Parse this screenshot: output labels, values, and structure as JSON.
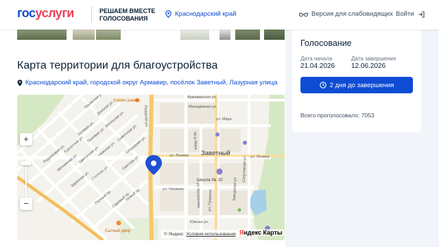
{
  "header": {
    "logo_part1": "гос",
    "logo_part2": "услуги",
    "slogan_line1": "РЕШАЕМ ВМЕСТЕ",
    "slogan_line2": "ГОЛОСОВАНИЯ",
    "region": "Краснодарский край",
    "accessibility": "Версия для слабовидящих",
    "login": "Войти"
  },
  "main": {
    "title": "Карта территории для благоустройства",
    "address": "Краснодарский край, городской округ Армавир, посёлок Заветный, Лазурная улица"
  },
  "map": {
    "pois": {
      "golden_palace": "Golden palace",
      "school": "Школа № 20",
      "sytny_dvor": "Сытный двор",
      "district": "Заветный"
    },
    "streets": {
      "lazurnaya": "Лазурная ул.",
      "armavirskaya": "Армавирская ул.",
      "molodezhnaya": "Молодёжная ул.",
      "mira": "ул. Мира",
      "lenina_w": "ул. Ленина",
      "lenina_e": "ул. Ленина",
      "chapaeva": "ул. Чапаева",
      "matrosova": "ул. Матросова",
      "pushkina": "ул. Пушкина",
      "zavodskaya": "Заводская ул.",
      "sportivnaya": "Спортивная ул.",
      "yuzhnaya": "Южная ул.",
      "krymskaya": "Крымская ул.",
      "donskaya": "Донская ул.",
      "shkolnaya": "Школьная ул.",
      "sovetskaya": "Советская ул.",
      "ogorodnaya": "Огородная ул.",
      "svetlaya": "Светлая ул.",
      "polevaya": "Полевая ул.",
      "tsvetochnaya": "Цветочная ул.",
      "stepnaya": "Степная ул.",
      "kurortnaya": "Курортная ул.",
      "mechnikova": "Мечникова ул.",
      "proezd": "пр-д Мира",
      "zarechnaya": "Заречная ул.",
      "rodnikovaya": "Родниковая ул.",
      "nevskaya": "Невская ул.",
      "lugovaya": "Луговая ул.",
      "polnoy": "Полный пр.",
      "sadovy": "Садовый пр.",
      "novy": "Новый пр."
    },
    "copyright": "© Яндекс",
    "terms": "Условия использования",
    "brand_y": "Я",
    "brand_rest": "ндекс Карты"
  },
  "vote": {
    "title": "Голосование",
    "start_label": "Дата начала",
    "start_value": "21.04.2026",
    "end_label": "Дата завершения",
    "end_value": "12.06.2026",
    "timer": "2 дня до завершения",
    "total": "Всего проголосовало: 7053"
  },
  "colors": {
    "brand_blue": "#0d4cd3",
    "brand_red": "#ee3f58",
    "map_marker": "#1e50d2",
    "main_road": "#f6c86a"
  }
}
